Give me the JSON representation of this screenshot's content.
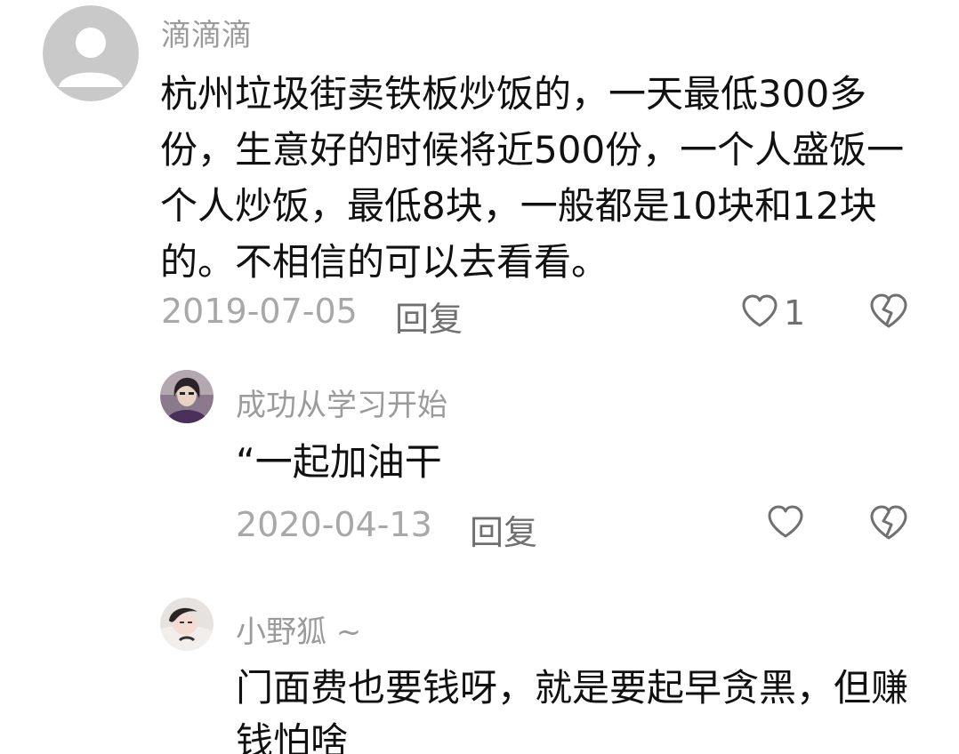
{
  "comments": [
    {
      "username": "滴滴滴",
      "content": "杭州垃圾街卖铁板炒饭的，一天最低300多份，生意好的时候将近500份，一个人盛饭一个人炒饭，最低8块，一般都是10块和12块的。不相信的可以去看看。",
      "date": "2019-07-05",
      "reply_label": "回复",
      "like_count": "1"
    },
    {
      "username": "成功从学习开始",
      "content": "“一起加油干",
      "date": "2020-04-13",
      "reply_label": "回复",
      "like_count": ""
    },
    {
      "username": "小野狐 ~",
      "content": "门面费也要钱呀，就是要起早贪黑，但赚钱怕啥"
    }
  ],
  "icons": {
    "like": "heart-outline-icon",
    "dislike": "broken-heart-icon",
    "default_avatar": "default-avatar-icon"
  },
  "colors": {
    "username": "#9b9b9b",
    "content": "#111111",
    "date": "#a8a8a8",
    "action": "#707070"
  }
}
